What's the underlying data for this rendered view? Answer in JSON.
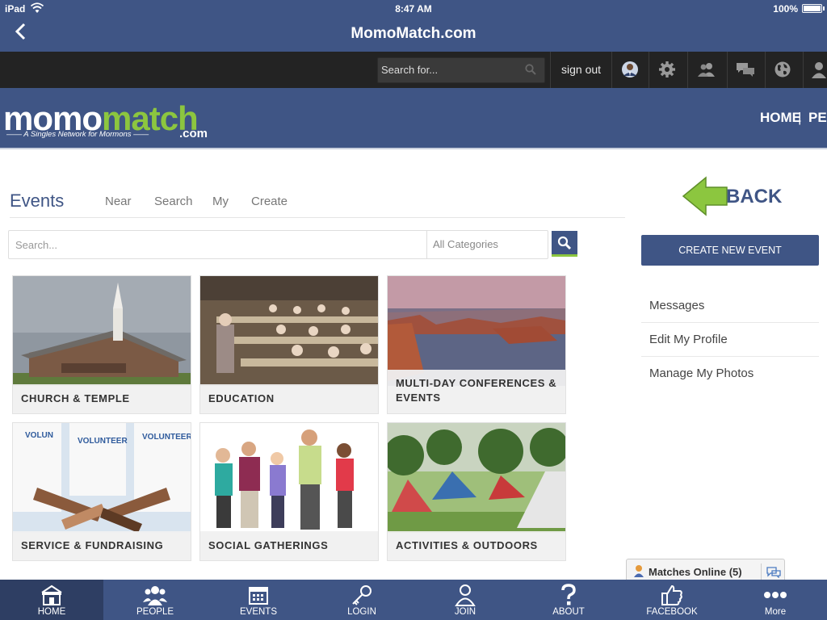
{
  "status_bar": {
    "carrier": "iPad",
    "time": "8:47 AM",
    "battery": "100%"
  },
  "nav_bar": {
    "title": "MomoMatch.com"
  },
  "toolbar": {
    "search_placeholder": "Search for...",
    "sign_out": "sign out"
  },
  "header": {
    "logo_momo": "momo",
    "logo_match": "match",
    "logo_tagline": "A Singles Network for Mormons",
    "logo_com": ".com",
    "nav": [
      "HOME",
      "PEO"
    ]
  },
  "events": {
    "title": "Events",
    "tabs": [
      "Near",
      "Search",
      "My",
      "Create"
    ],
    "search_placeholder": "Search...",
    "category_value": "All Categories"
  },
  "tiles": [
    {
      "label": "CHURCH & TEMPLE"
    },
    {
      "label": "EDUCATION"
    },
    {
      "label": "MULTI-DAY CONFERENCES & EVENTS"
    },
    {
      "label": "SERVICE & FUNDRAISING"
    },
    {
      "label": "SOCIAL GATHERINGS"
    },
    {
      "label": "ACTIVITIES & OUTDOORS"
    }
  ],
  "sidebar": {
    "back_label": "BACK",
    "create_button": "CREATE NEW EVENT",
    "links": [
      "Messages",
      "Edit My Profile",
      "Manage My Photos"
    ]
  },
  "matches_online": {
    "label": "Matches Online (5)"
  },
  "tabbar": {
    "items": [
      {
        "label": "HOME",
        "icon": "home-icon"
      },
      {
        "label": "PEOPLE",
        "icon": "people-icon"
      },
      {
        "label": "EVENTS",
        "icon": "calendar-icon"
      },
      {
        "label": "LOGIN",
        "icon": "key-icon"
      },
      {
        "label": "JOIN",
        "icon": "user-icon"
      },
      {
        "label": "ABOUT",
        "icon": "question-icon"
      },
      {
        "label": "FACEBOOK",
        "icon": "thumbs-up-icon"
      },
      {
        "label": "More",
        "icon": "more-dots-icon"
      }
    ]
  },
  "colors": {
    "brand_blue": "#3f5585",
    "accent_green": "#8cc63f",
    "toolbar_dark": "#232323"
  }
}
